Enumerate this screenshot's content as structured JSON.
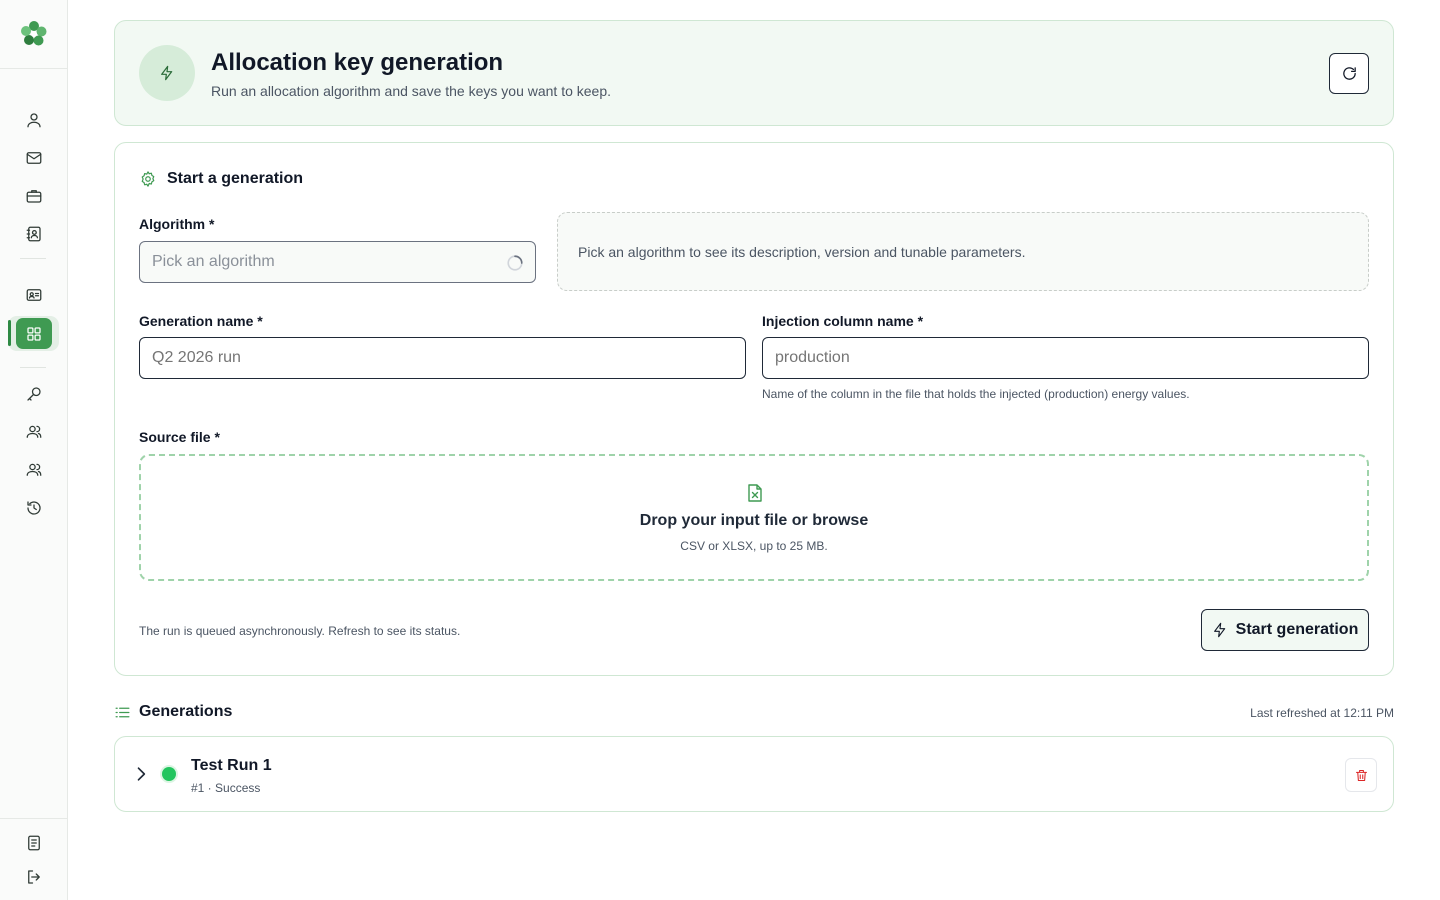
{
  "app": {
    "logo_icon": "clover-logo-icon"
  },
  "sidebar": {
    "items": [
      {
        "name": "user-icon"
      },
      {
        "name": "mail-icon"
      },
      {
        "name": "briefcase-icon"
      },
      {
        "name": "contact-book-icon"
      },
      {
        "name": "id-card-icon"
      },
      {
        "name": "grid-icon",
        "active": true
      },
      {
        "name": "key-icon"
      },
      {
        "name": "users-icon"
      },
      {
        "name": "group-icon"
      },
      {
        "name": "history-icon"
      }
    ],
    "bottom": [
      {
        "name": "docs-icon"
      },
      {
        "name": "logout-icon"
      }
    ],
    "accent_color": "#3f9a52"
  },
  "header": {
    "title": "Allocation key generation",
    "subtitle": "Run an allocation algorithm and save the keys you want to keep."
  },
  "form": {
    "section_title": "Start a generation",
    "algorithm": {
      "label": "Algorithm *",
      "placeholder": "Pick an algorithm",
      "info_text": "Pick an algorithm to see its description, version and tunable parameters."
    },
    "generation_name": {
      "label": "Generation name *",
      "placeholder": "Q2 2026 run"
    },
    "injection_column": {
      "label": "Injection column name *",
      "placeholder": "production",
      "helper": "Name of the column in the file that holds the injected (production) energy values."
    },
    "source_file": {
      "label": "Source file *",
      "drop_title": "Drop your input file or browse",
      "drop_sub": "CSV or XLSX, up to 25 MB."
    },
    "footer_note": "The run is queued asynchronously. Refresh to see its status.",
    "submit_label": "Start generation"
  },
  "generations": {
    "title": "Generations",
    "last_refreshed": "Last refreshed at 12:11 PM",
    "rows": [
      {
        "title": "Test Run 1",
        "subtitle": "#1 · Success",
        "status": "success",
        "status_color": "#22c55e"
      }
    ]
  }
}
